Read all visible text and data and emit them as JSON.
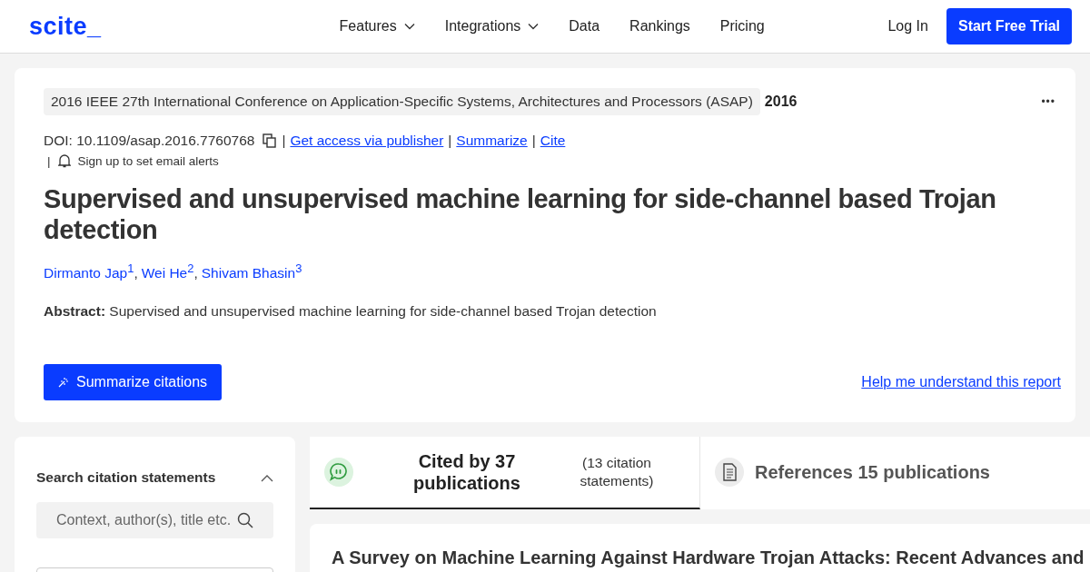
{
  "header": {
    "logo": "scite_",
    "nav": [
      {
        "label": "Features",
        "dropdown": true
      },
      {
        "label": "Integrations",
        "dropdown": true
      },
      {
        "label": "Data",
        "dropdown": false
      },
      {
        "label": "Rankings",
        "dropdown": false
      },
      {
        "label": "Pricing",
        "dropdown": false
      }
    ],
    "login": "Log In",
    "cta": "Start Free Trial"
  },
  "paper": {
    "venue": "2016 IEEE 27th International Conference on Application-Specific Systems, Architectures and Processors (ASAP)",
    "year": "2016",
    "more": "•••",
    "doi": "DOI: 10.1109/asap.2016.7760768",
    "links": [
      "Get access via publisher",
      "Summarize",
      "Cite"
    ],
    "separator": "|",
    "alerts": "Sign up to set email alerts",
    "title": "Supervised and unsupervised machine learning for side-channel based Trojan detection",
    "author_separator": ",",
    "authors": [
      "Dirmanto Jap$^{1}$",
      "Wei He$^{2}$",
      "Shivam Bhasin$^{3}$"
    ],
    "abstract_label": "Abstract:",
    "abstract": "Supervised and unsupervised machine learning for side-channel based Trojan detection",
    "summarize_button": "Summarize citations",
    "help_link": "Help me understand this report"
  },
  "sidebar": {
    "heading": "Search citation statements",
    "expanded": true,
    "search": {
      "placeholder": "Context, author(s), title etc."
    }
  },
  "tabs": [
    {
      "kind": "citing",
      "label": "Cited by 37 publications",
      "note": "(13 citation statements)",
      "selected": true
    },
    {
      "kind": "references",
      "label": "References 15 publications",
      "selected": false
    }
  ],
  "results": [
    {
      "title": "A Survey on Machine Learning Against Hardware Trojan Attacks: Recent Advances and"
    }
  ]
}
